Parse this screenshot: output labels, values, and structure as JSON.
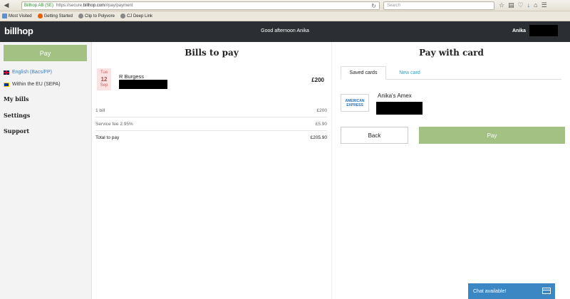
{
  "browser": {
    "site_identity": "Billhop AB (SE)",
    "url_prefix": "https://secure.",
    "url_domain": "billhop.com",
    "url_path": "/#pay/payment",
    "search_placeholder": "Search",
    "bookmarks": [
      "Most Visited",
      "Getting Started",
      "Clip to Polyvore",
      "CJ Deep Link"
    ]
  },
  "header": {
    "logo": "billhop",
    "greeting": "Good afternoon Anika",
    "user_name": "Anika"
  },
  "sidebar": {
    "pay_label": "Pay",
    "languages": [
      "English (Bacs/FP)",
      "Within the EU (SEPA)"
    ],
    "links": [
      "My bills",
      "Settings",
      "Support"
    ]
  },
  "bills": {
    "title": "Bills to pay",
    "date": {
      "weekday": "Tue",
      "day": "12",
      "month": "Sep"
    },
    "payee": "R Burgess",
    "amount": "£200",
    "summary": [
      {
        "label": "1 bill",
        "value": "£200"
      },
      {
        "label": "Service fee 2.95%",
        "value": "£5.90"
      },
      {
        "label": "Total to pay",
        "value": "£205.90"
      }
    ]
  },
  "pay_card": {
    "title": "Pay with card",
    "tabs": [
      "Saved cards",
      "New card"
    ],
    "card_logo_line1": "AMERICAN",
    "card_logo_line2": "EXPRESS",
    "card_name": "Anika's Amex",
    "back_label": "Back",
    "pay_label": "Pay"
  },
  "chat": {
    "label": "Chat available!"
  },
  "colors": {
    "accent_green": "#a3c182",
    "header_dark": "#2b2f33",
    "link_blue": "#3ba0c7",
    "chat_blue": "#3b87c4"
  }
}
